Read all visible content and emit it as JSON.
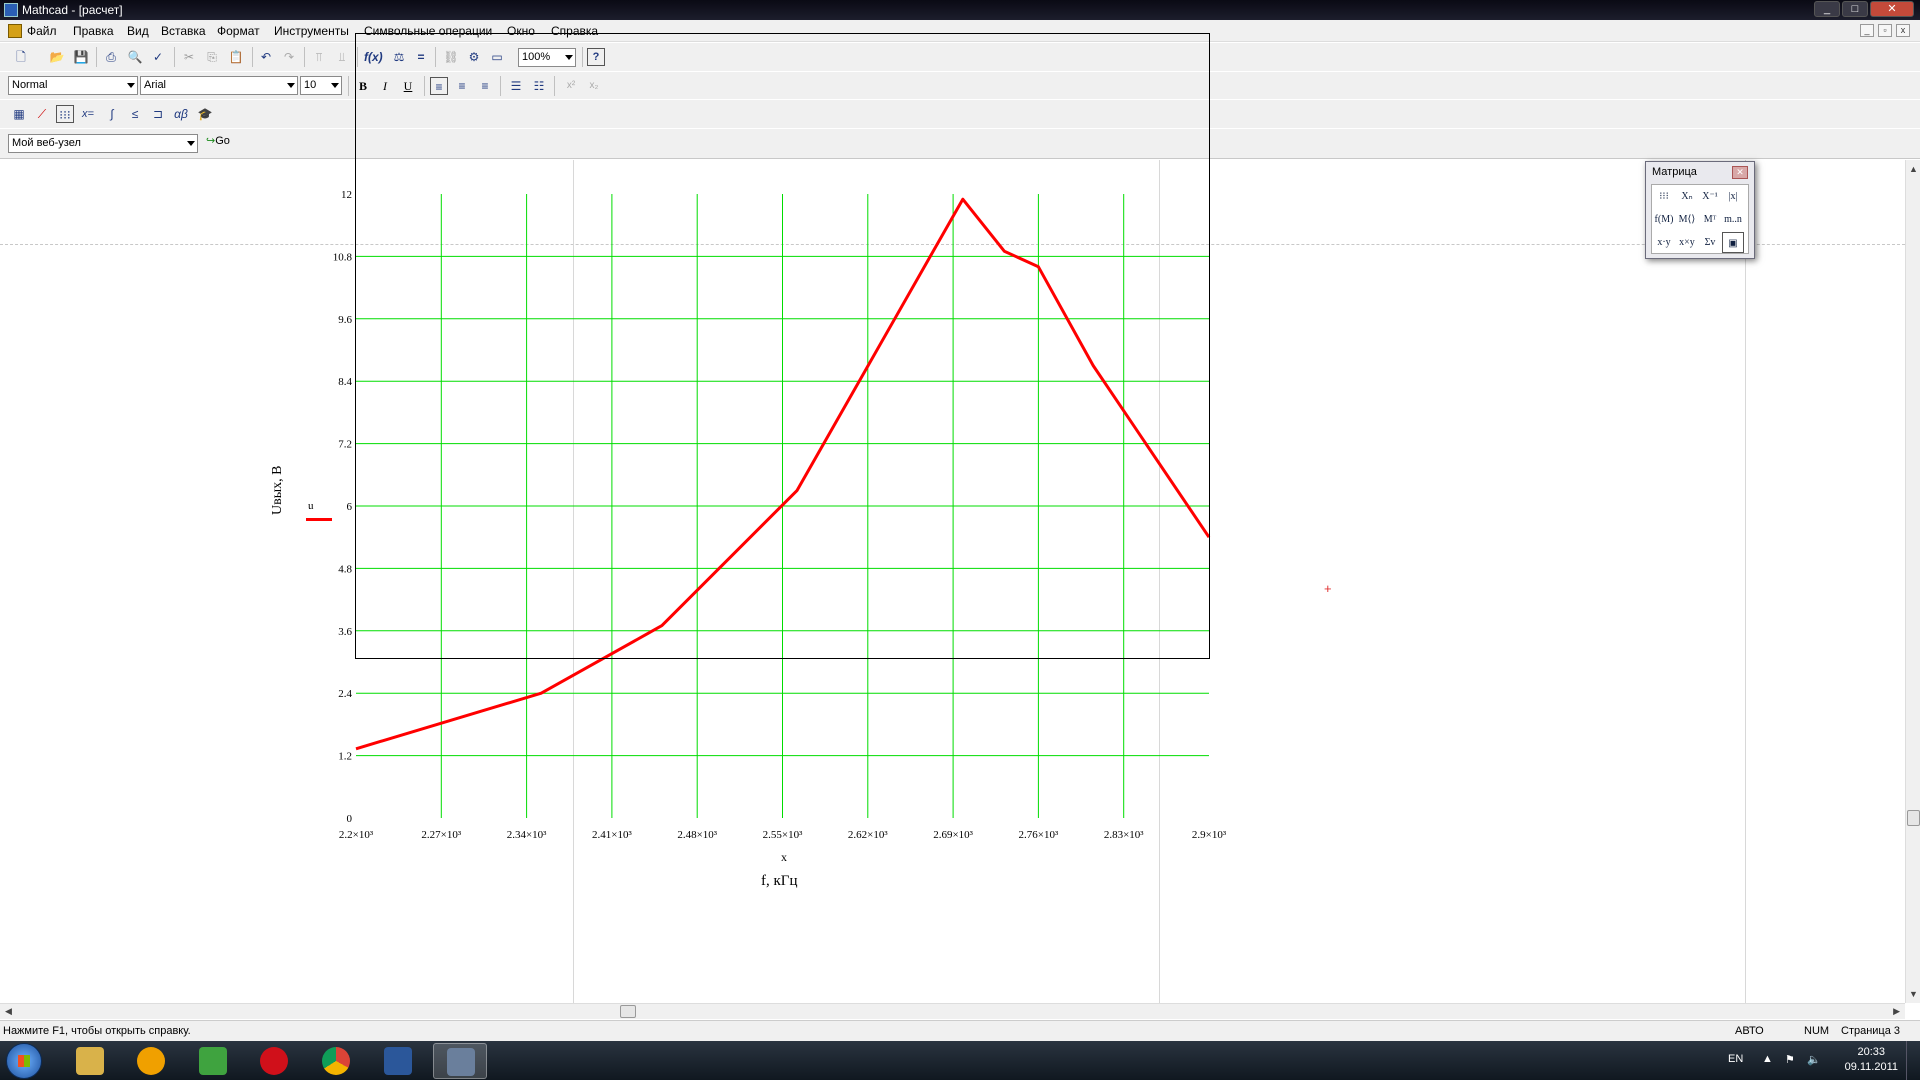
{
  "window": {
    "title": "Mathcad - [расчет]"
  },
  "menu": [
    "Файл",
    "Правка",
    "Вид",
    "Вставка",
    "Формат",
    "Инструменты",
    "Символьные операции",
    "Окно",
    "Справка"
  ],
  "toolbar": {
    "zoom": "100%",
    "style": "Normal",
    "font": "Arial",
    "font_size": "10",
    "bold": "B",
    "italic": "I",
    "underline": "U",
    "web_node": "Мой веб-узел",
    "go": "Go"
  },
  "matrix_palette": {
    "title": "Матрица"
  },
  "plot": {
    "y_axis_label": "Uвых, В",
    "legend_trace": "u",
    "x_var": "x",
    "x_axis_label": "f, кГц"
  },
  "chart_data": {
    "type": "line",
    "xlabel": "f, кГц",
    "ylabel": "Uвых, В",
    "xlim": [
      2200,
      2900
    ],
    "ylim": [
      0,
      12
    ],
    "grid": true,
    "x_ticks": [
      "2.2×10³",
      "2.27×10³",
      "2.34×10³",
      "2.41×10³",
      "2.48×10³",
      "2.55×10³",
      "2.62×10³",
      "2.69×10³",
      "2.76×10³",
      "2.83×10³",
      "2.9×10³"
    ],
    "y_ticks": [
      "0",
      "1.2",
      "2.4",
      "3.6",
      "4.8",
      "6",
      "7.2",
      "8.4",
      "9.6",
      "10.8",
      "12"
    ],
    "series": [
      {
        "name": "u",
        "color": "#ff0000",
        "x": [
          2200,
          2352,
          2451,
          2562,
          2698,
          2732,
          2760,
          2805,
          2900
        ],
        "y": [
          1.33,
          2.4,
          3.7,
          6.3,
          11.9,
          10.9,
          10.6,
          8.7,
          5.4
        ]
      }
    ],
    "grid_color": "#00dd00",
    "line_color": "#ff0000"
  },
  "status": {
    "help": "Нажмите F1, чтобы открыть справку.",
    "mode": "АВТО",
    "num": "NUM",
    "page": "Страница 3"
  },
  "taskbar": {
    "lang": "EN",
    "time": "20:33",
    "date": "09.11.2011"
  }
}
